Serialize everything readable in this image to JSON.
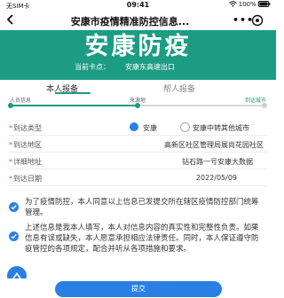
{
  "status_bar": {
    "left_text": "无SIM卡",
    "time": "09:41",
    "battery": "100%"
  },
  "navbar": {
    "title": "安康市疫情精准防控信息..."
  },
  "banner": {
    "title": "安康防疫",
    "checkpoint_label": "当前卡点：",
    "checkpoint_value": "安康东高速出口"
  },
  "tabs": [
    {
      "label": "本人报备",
      "active": true
    },
    {
      "label": "帮人报备",
      "active": false
    }
  ],
  "progress": {
    "steps": [
      "人员信息",
      "来源地",
      "到达城市"
    ],
    "completed_fraction": 0.5
  },
  "form": {
    "arrival_type": {
      "label": "到达类型",
      "options": [
        "安康",
        "安康中转其他城市"
      ],
      "selected": "安康"
    },
    "arrival_area": {
      "label": "到达地区",
      "value": "高新区社区管理局展尚花园社区"
    },
    "address": {
      "label": "详细地址",
      "value": "钻石路一号安康大数据"
    },
    "arrival_date": {
      "label": "到达日期",
      "value": "2022/05/09"
    }
  },
  "consents": [
    {
      "text": "为了疫情防控，本人同意以上信息已发提交所在辖区疫情防控部门统筹管理。",
      "checked": true
    },
    {
      "text": "上述信息是我本人填写，本人对信息内容的真实性和完整性负责。如果信息有误或缺失，本人愿意承担相应法律责任。同时，本人保证遵守防疫管控的各项规定，配合并听从各项措施和要求。",
      "checked": true
    }
  ],
  "submit_label": "提交",
  "colors": {
    "brand_green": "#1d9c84",
    "accent_blue": "#2b7fe4",
    "required_red": "#e74c3c"
  }
}
